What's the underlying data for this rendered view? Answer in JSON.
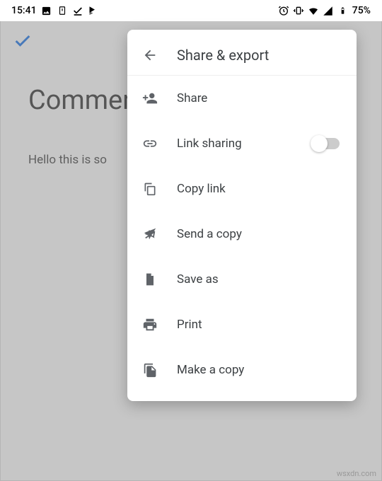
{
  "status_bar": {
    "time": "15:41",
    "battery_text": "75%"
  },
  "document": {
    "title": "Comment usage",
    "paragraph": "Hello this is so"
  },
  "sheet": {
    "title": "Share & export",
    "items": {
      "share": "Share",
      "link_sharing": "Link sharing",
      "copy_link": "Copy link",
      "send_copy": "Send a copy",
      "save_as": "Save as",
      "print": "Print",
      "make_copy": "Make a copy"
    },
    "link_sharing_on": false
  },
  "watermark": "wsxdn.com"
}
